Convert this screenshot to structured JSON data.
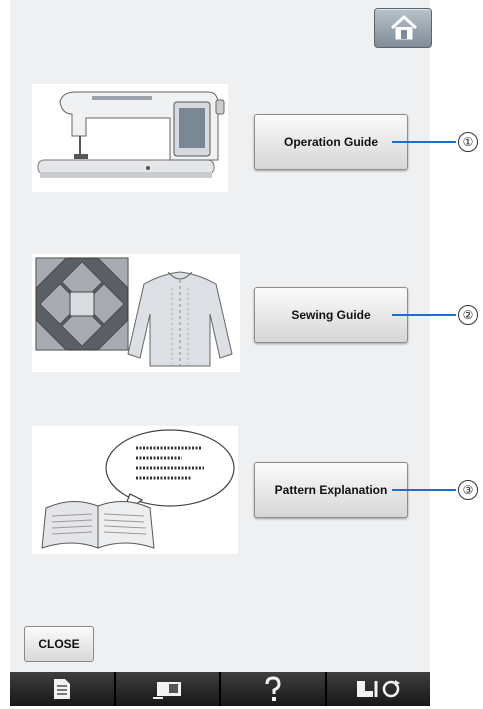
{
  "header": {
    "home_icon": "home-icon"
  },
  "options": [
    {
      "label": "Operation Guide",
      "callout": "①",
      "illustration": "sewing-machine-illustration"
    },
    {
      "label": "Sewing Guide",
      "callout": "②",
      "illustration": "quilt-and-blouse-illustration"
    },
    {
      "label": "Pattern Explanation",
      "callout": "③",
      "illustration": "open-book-speech-bubble-illustration"
    }
  ],
  "footer": {
    "close_label": "CLOSE"
  },
  "tabbar": {
    "tabs": [
      {
        "icon": "document-icon"
      },
      {
        "icon": "machine-settings-icon"
      },
      {
        "icon": "help-icon"
      },
      {
        "icon": "presser-foot-rotate-icon"
      }
    ]
  },
  "colors": {
    "accent_line": "#1e6ed1",
    "screen_bg": "#eef0f2",
    "tabbar_bg": "#1a1a1a"
  }
}
